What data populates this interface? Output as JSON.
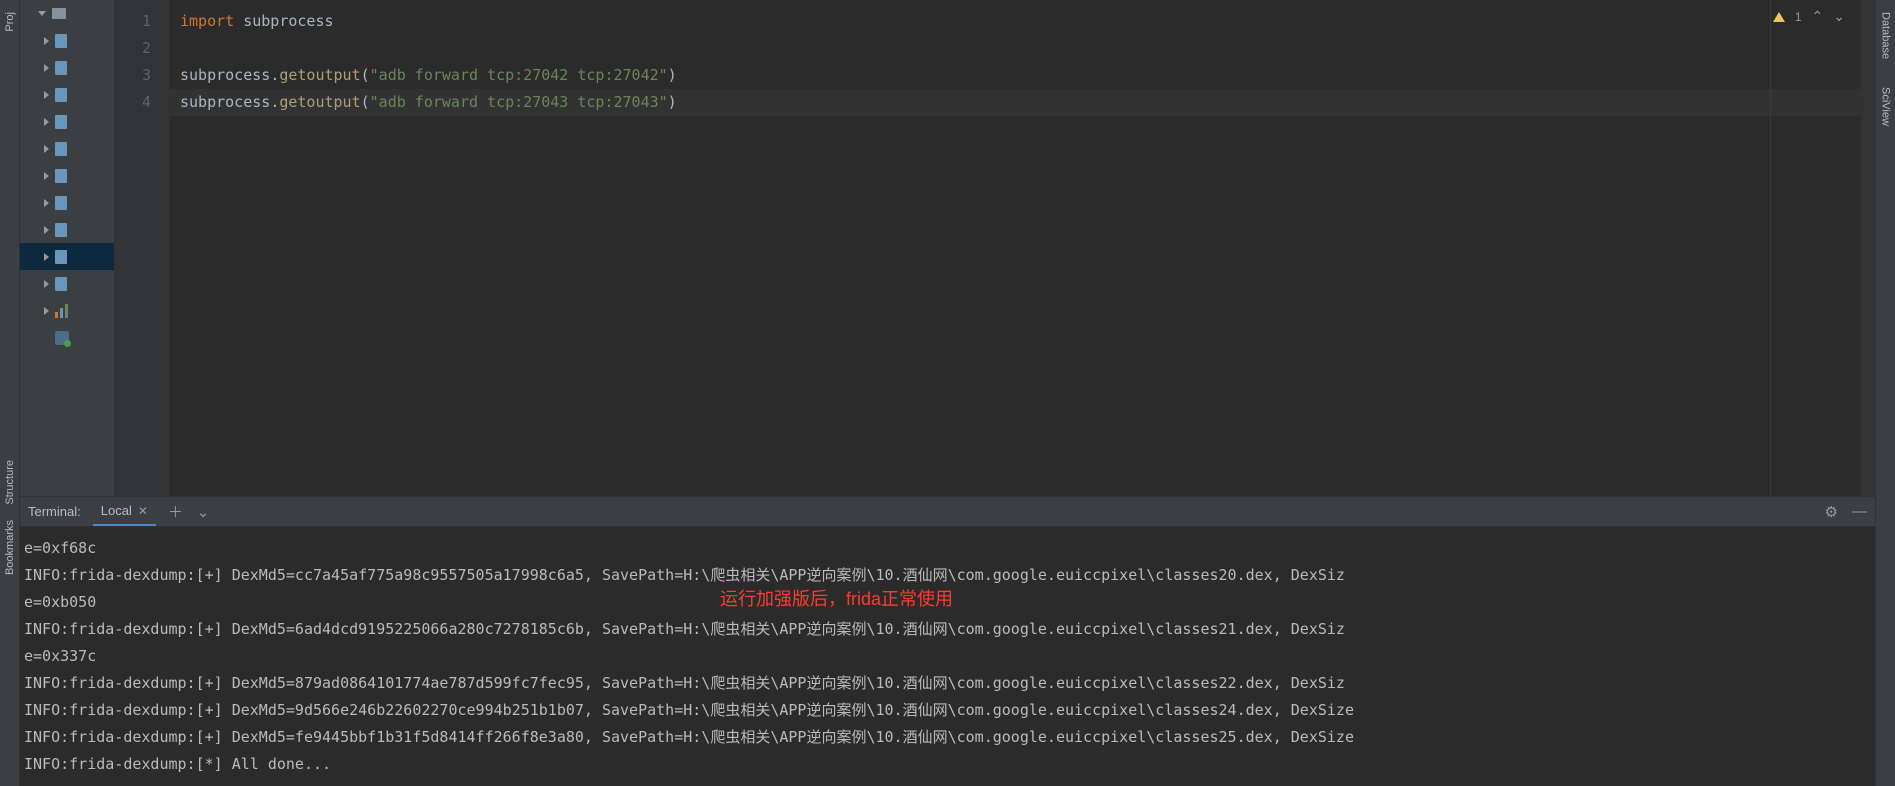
{
  "left_sidebar": {
    "labels": [
      "Proj",
      "Structure",
      "Bookmarks"
    ]
  },
  "right_sidebar": {
    "labels": [
      "Database",
      "SciView"
    ]
  },
  "editor": {
    "line_numbers": [
      "1",
      "2",
      "3",
      "4"
    ],
    "code": {
      "l1_import": "import",
      "l1_module": " subprocess",
      "l3_obj": "subprocess",
      "l3_dot": ".",
      "l3_fn": "getoutput",
      "l3_open": "(",
      "l3_str": "\"adb forward tcp:27042 tcp:27042\"",
      "l3_close": ")",
      "l4_obj": "subprocess",
      "l4_dot": ".",
      "l4_fn": "getoutput",
      "l4_open": "(",
      "l4_str": "\"adb forward tcp:27043 tcp:27043\"",
      "l4_close": ")"
    },
    "inspection_count": "1"
  },
  "terminal": {
    "title": "Terminal:",
    "tab": "Local",
    "lines": [
      "e=0xf68c",
      "INFO:frida-dexdump:[+] DexMd5=cc7a45af775a98c9557505a17998c6a5, SavePath=H:\\爬虫相关\\APP逆向案例\\10.酒仙网\\com.google.euiccpixel\\classes20.dex, DexSiz",
      "e=0xb050",
      "INFO:frida-dexdump:[+] DexMd5=6ad4dcd9195225066a280c7278185c6b, SavePath=H:\\爬虫相关\\APP逆向案例\\10.酒仙网\\com.google.euiccpixel\\classes21.dex, DexSiz",
      "e=0x337c",
      "INFO:frida-dexdump:[+] DexMd5=879ad0864101774ae787d599fc7fec95, SavePath=H:\\爬虫相关\\APP逆向案例\\10.酒仙网\\com.google.euiccpixel\\classes22.dex, DexSiz",
      "INFO:frida-dexdump:[+] DexMd5=9d566e246b22602270ce994b251b1b07, SavePath=H:\\爬虫相关\\APP逆向案例\\10.酒仙网\\com.google.euiccpixel\\classes24.dex, DexSize",
      "INFO:frida-dexdump:[+] DexMd5=fe9445bbf1b31f5d8414ff266f8e3a80, SavePath=H:\\爬虫相关\\APP逆向案例\\10.酒仙网\\com.google.euiccpixel\\classes25.dex, DexSize",
      "INFO:frida-dexdump:[*] All done..."
    ],
    "overlay": "运行加强版后，frida正常使用"
  }
}
